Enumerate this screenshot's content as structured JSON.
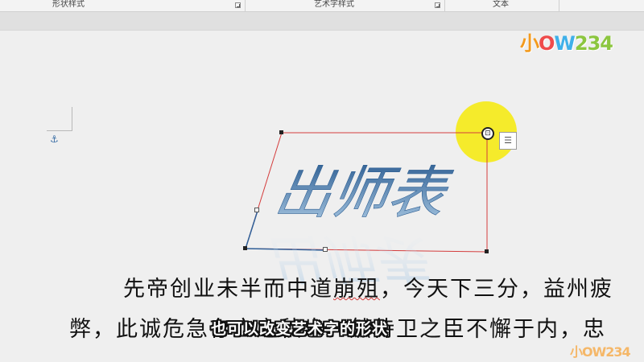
{
  "ribbon": {
    "groups": [
      {
        "label": "形状样式"
      },
      {
        "label": "艺术字样式"
      },
      {
        "label": "文本"
      }
    ]
  },
  "logo": {
    "text_parts": [
      "小",
      "O",
      "W",
      "234"
    ],
    "bottom_text": "小OW234"
  },
  "word_art": {
    "text": "出师表",
    "colors": {
      "top": "#2e5f93",
      "bottom": "#9fc1de"
    }
  },
  "document": {
    "line1_before": "先帝创业未半而中道",
    "line1_squiggle": "崩殂",
    "line1_after": "，今天下三分，益州疲",
    "line2": "弊，此诚危急存亡之秋也。然侍卫之臣不懈于内，忠"
  },
  "caption": {
    "text": "也可以改变艺术字的形状"
  },
  "icons": {
    "anchor": "anchor-icon",
    "rotate": "rotate-handle-icon",
    "layout": "layout-options-icon"
  },
  "colors": {
    "selection_border": "#d43c3c",
    "highlight": "#f5ea1a"
  }
}
